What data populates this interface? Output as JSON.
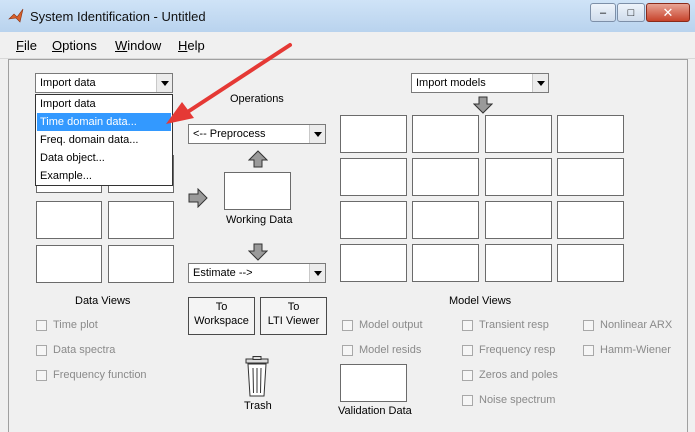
{
  "window": {
    "title": "System Identification - Untitled",
    "close_glyph": "✕",
    "minimize_glyph": "–",
    "maximize_glyph": "□"
  },
  "menu": [
    {
      "mnemonic": "F",
      "rest": "ile"
    },
    {
      "mnemonic": "O",
      "rest": "ptions"
    },
    {
      "mnemonic": "W",
      "rest": "indow"
    },
    {
      "mnemonic": "H",
      "rest": "elp"
    }
  ],
  "import_data": {
    "selected": "Import data",
    "options": [
      "Import data",
      "Time domain data...",
      "Freq. domain data...",
      "Data object...",
      "Example..."
    ],
    "highlighted_index": 1
  },
  "import_models": {
    "selected": "Import models"
  },
  "operations": {
    "label": "Operations",
    "preprocess": "<-- Preprocess",
    "working_data": "Working Data",
    "estimate": "Estimate -->"
  },
  "buttons": {
    "to_workspace": [
      "To",
      "Workspace"
    ],
    "to_lti_viewer": [
      "To",
      "LTI Viewer"
    ]
  },
  "trash": "Trash",
  "validation_data": "Validation Data",
  "data_views": {
    "label": "Data Views",
    "items": [
      "Time plot",
      "Data spectra",
      "Frequency function"
    ]
  },
  "model_views": {
    "label": "Model Views",
    "col1": [
      "Model output",
      "Model resids"
    ],
    "col2": [
      "Transient resp",
      "Frequency resp",
      "Zeros and poles",
      "Noise spectrum"
    ],
    "col3": [
      "Nonlinear ARX",
      "Hamm-Wiener"
    ]
  },
  "colors": {
    "highlight": "#3399ff",
    "annotation_arrow": "#e53935",
    "title_bar": "#c4dbf2"
  }
}
